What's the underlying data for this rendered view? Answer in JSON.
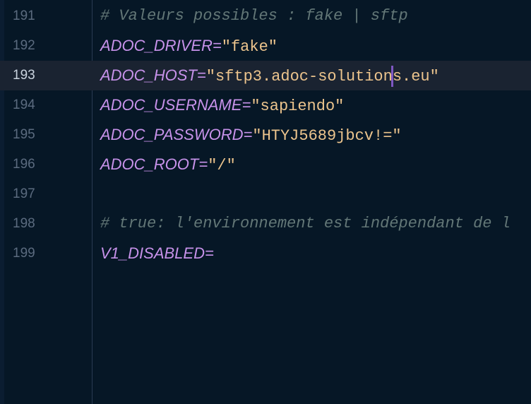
{
  "editor": {
    "lines": [
      {
        "number": "191",
        "comment": "# Valeurs possibles : fake | sftp"
      },
      {
        "number": "192",
        "key": "ADOC_DRIVER",
        "eq": "=",
        "value": "\"fake\""
      },
      {
        "number": "193",
        "key": "ADOC_HOST",
        "eq": "=",
        "value_before_caret": "\"sftp3.adoc-solution",
        "value_after_caret": "s.eu\""
      },
      {
        "number": "194",
        "key": "ADOC_USERNAME",
        "eq": "=",
        "value": "\"sapiendo\""
      },
      {
        "number": "195",
        "key": "ADOC_PASSWORD",
        "eq": "=",
        "value": "\"HTYJ5689jbcv!=\""
      },
      {
        "number": "196",
        "key": "ADOC_ROOT",
        "eq": "=",
        "value": "\"/\""
      },
      {
        "number": "197"
      },
      {
        "number": "198",
        "comment": "# true: l'environnement est indépendant de l"
      },
      {
        "number": "199",
        "key": "V1_DISABLED",
        "eq": "="
      }
    ],
    "active_line": "193"
  },
  "colors": {
    "background": "#061726",
    "active_line": "#1a2331",
    "key": "#c792ea",
    "string": "#ecc48d",
    "comment": "#637777",
    "line_number": "#5b6b7f",
    "active_line_number": "#c9d3de",
    "caret": "#7e57c2"
  }
}
